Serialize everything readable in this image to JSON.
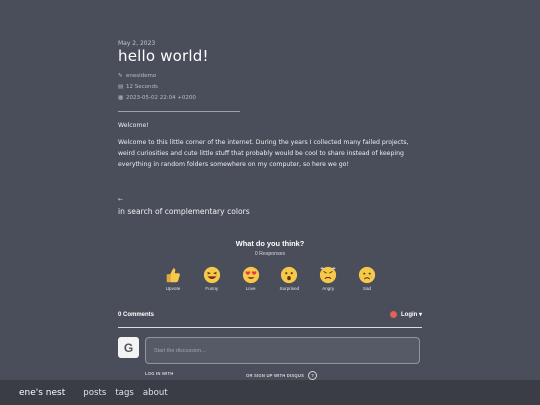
{
  "post": {
    "date": "May 2, 2023",
    "title": "hello world!",
    "author": "enesidemo",
    "read_time": "12 Seconds",
    "timestamp": "2023-05-02 22:04 +0200",
    "paragraphs": [
      "Welcome!",
      "Welcome to this little corner of the internet. During the years I collected many failed projects, weird curiosities and cute little stuff that probably would be cool to share instead of keeping everything in random folders somewhere on my computer, so here we go!"
    ]
  },
  "post_nav": {
    "back_arrow": "←",
    "next_post": "in search of complementary colors"
  },
  "disqus": {
    "question": "What do you think?",
    "responses": "0 Responses",
    "reactions": [
      {
        "label": "Upvote",
        "icon": "thumbs-up-icon"
      },
      {
        "label": "Funny",
        "icon": "laughing-face-icon"
      },
      {
        "label": "Love",
        "icon": "heart-eyes-icon"
      },
      {
        "label": "Surprised",
        "icon": "surprised-face-icon"
      },
      {
        "label": "Angry",
        "icon": "angry-face-icon"
      },
      {
        "label": "Sad",
        "icon": "sad-face-icon"
      }
    ],
    "comments_count": "0 Comments",
    "login": "Login ▾",
    "avatar_letter": "G",
    "placeholder": "Start the discussion…",
    "login_with": "LOG IN WITH",
    "signup_with": "OR SIGN UP WITH DISQUS",
    "help": "?"
  },
  "footer": {
    "brand": "ene's nest",
    "nav": [
      "posts",
      "tags",
      "about"
    ]
  },
  "colors": {
    "background": "#4a4e5a",
    "footer": "#3a3d46",
    "emoji_yellow": "#f7c84a"
  }
}
